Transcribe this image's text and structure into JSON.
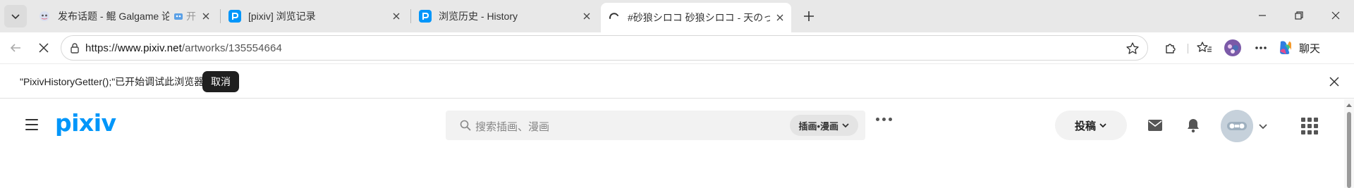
{
  "browser": {
    "tabs": [
      {
        "title": "发布话题 - 鲲 Galgame 论坛",
        "extra_label": "开",
        "favicon": "galgame-favicon-icon",
        "active": false
      },
      {
        "title": "[pixiv] 浏览记录",
        "favicon": "pixiv-favicon-icon",
        "active": false
      },
      {
        "title": "浏览历史 - History",
        "favicon": "pixiv-favicon-icon",
        "active": false
      },
      {
        "title": "#砂狼シロコ 砂狼シロコ - 天のっ",
        "favicon": "loading-spinner-icon",
        "active": true
      }
    ],
    "address": {
      "scheme": "https://",
      "host": "www.pixiv.net",
      "path": "/artworks/135554664"
    },
    "chat_label": "聊天",
    "accent_colors": {
      "pixiv_blue": "#0096fa",
      "infobar_button": "#1f1f1f"
    }
  },
  "infobar": {
    "message": "\"PixivHistoryGetter();\"已开始调试此浏览器",
    "cancel_label": "取消"
  },
  "pixiv": {
    "logo": "pixiv",
    "search_placeholder": "搜索插画、漫画",
    "search_type": "插画•漫画",
    "post_label": "投稿"
  }
}
